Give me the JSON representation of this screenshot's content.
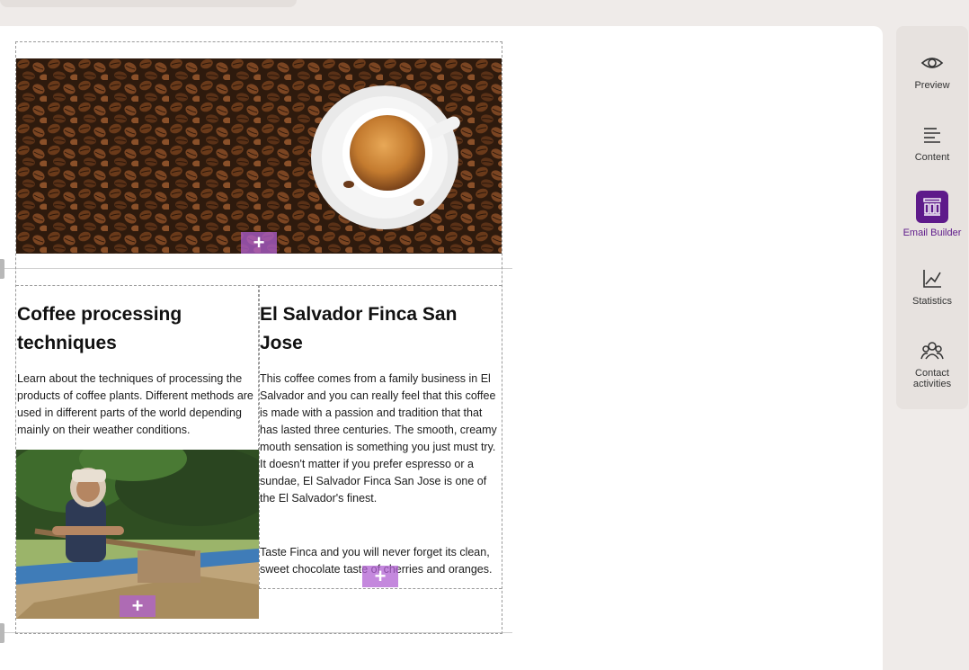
{
  "email": {
    "left_column": {
      "heading": "Coffee processing techniques",
      "body": "Learn about the techniques of processing the products of coffee plants. Different methods are used in different parts of the world depending mainly on their weather conditions."
    },
    "right_column": {
      "heading": "El Salvador Finca San Jose",
      "body": "This coffee comes from a family business in El Salvador and you can really feel that this coffee is made with a passion and tradition that that has lasted three centuries. The smooth, creamy mouth sensation is something you just must try. It doesn't matter if you prefer espresso or a sundae, El Salvador Finca San Jose is one of the El Salvador's finest.",
      "body2": "Taste Finca and you will never forget its clean, sweet chocolate taste of cherries and oranges."
    },
    "add_glyph": "+"
  },
  "sidebar": {
    "items": [
      {
        "label": "Preview",
        "icon": "eye-icon"
      },
      {
        "label": "Content",
        "icon": "align-left-icon"
      },
      {
        "label": "Email Builder",
        "icon": "email-builder-icon",
        "active": true
      },
      {
        "label": "Statistics",
        "icon": "chart-icon"
      },
      {
        "label": "Contact activities",
        "icon": "people-icon"
      }
    ],
    "accent": "#5e1a8a"
  }
}
